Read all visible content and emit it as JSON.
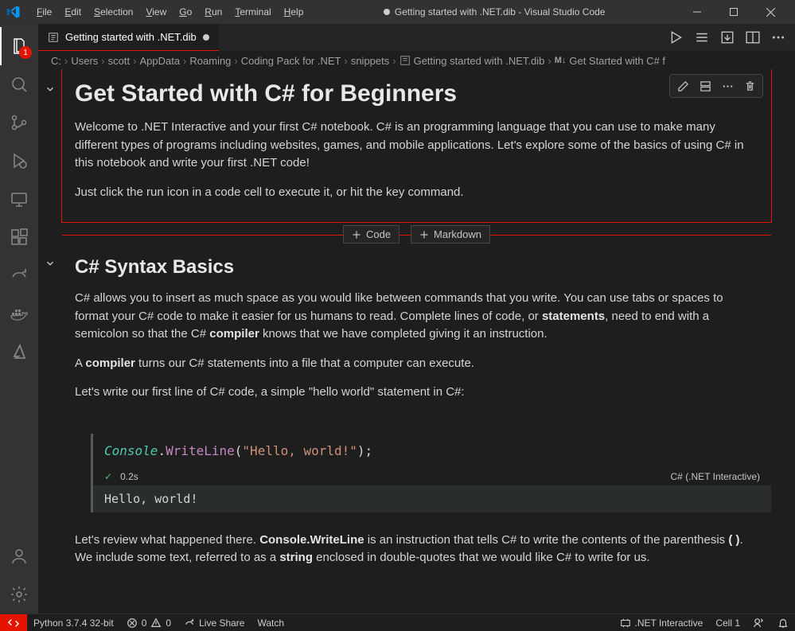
{
  "menu": {
    "file": "File",
    "edit": "Edit",
    "selection": "Selection",
    "view": "View",
    "go": "Go",
    "run": "Run",
    "terminal": "Terminal",
    "help": "Help"
  },
  "window_title": "Getting started with .NET.dib - Visual Studio Code",
  "tab": {
    "name": "Getting started with .NET.dib"
  },
  "activity_badge": "1",
  "breadcrumb": {
    "p0": "C:",
    "p1": "Users",
    "p2": "scott",
    "p3": "AppData",
    "p4": "Roaming",
    "p5": "Coding Pack for .NET",
    "p6": "snippets",
    "p7": "Getting started with .NET.dib",
    "p8": "Get Started with C# f"
  },
  "insert": {
    "code": "Code",
    "markdown": "Markdown"
  },
  "cell1": {
    "h1": "Get Started with C# for Beginners",
    "p1": "Welcome to .NET Interactive and your first C# notebook. C# is an programming language that you can use to make many different types of programs including websites, games, and mobile applications. Let's explore some of the basics of using C# in this notebook and write your first .NET code!",
    "p2": "Just click the run icon in a code cell to execute it, or hit the key command."
  },
  "cell2": {
    "h2": "C# Syntax Basics",
    "p1a": "C# allows you to insert as much space as you would like between commands that you write. You can use tabs or spaces to format your C# code to make it easier for us humans to read. Complete lines of code, or ",
    "p1b": "statements",
    "p1c": ", need to end with a semicolon so that the C# ",
    "p1d": "compiler",
    "p1e": " knows that we have completed giving it an instruction.",
    "p2a": "A ",
    "p2b": "compiler",
    "p2c": " turns our C# statements into a file that a computer can execute.",
    "p3": "Let's write our first line of C# code, a simple \"hello world\" statement in C#:"
  },
  "code": {
    "obj": "Console",
    "dot": ".",
    "fn": "WriteLine",
    "open": "(",
    "str": "\"Hello, world!\"",
    "close": ");",
    "time": "0.2s",
    "lang": "C# (.NET Interactive)",
    "output": "Hello, world!"
  },
  "cell3": {
    "t1": "Let's review what happened there. ",
    "t2": "Console.WriteLine",
    "t3": " is an instruction that tells C# to write the contents of the parenthesis ",
    "t4": "( )",
    "t5": ". We include some text, referred to as a ",
    "t6": "string",
    "t7": " enclosed in double-quotes that we would like C# to write for us."
  },
  "status": {
    "python": "Python 3.7.4 32-bit",
    "errors": "0",
    "warnings": "0",
    "liveshare": "Live Share",
    "watch": "Watch",
    "kernel": ".NET Interactive",
    "cell": "Cell 1"
  },
  "md_badge": "M↓"
}
